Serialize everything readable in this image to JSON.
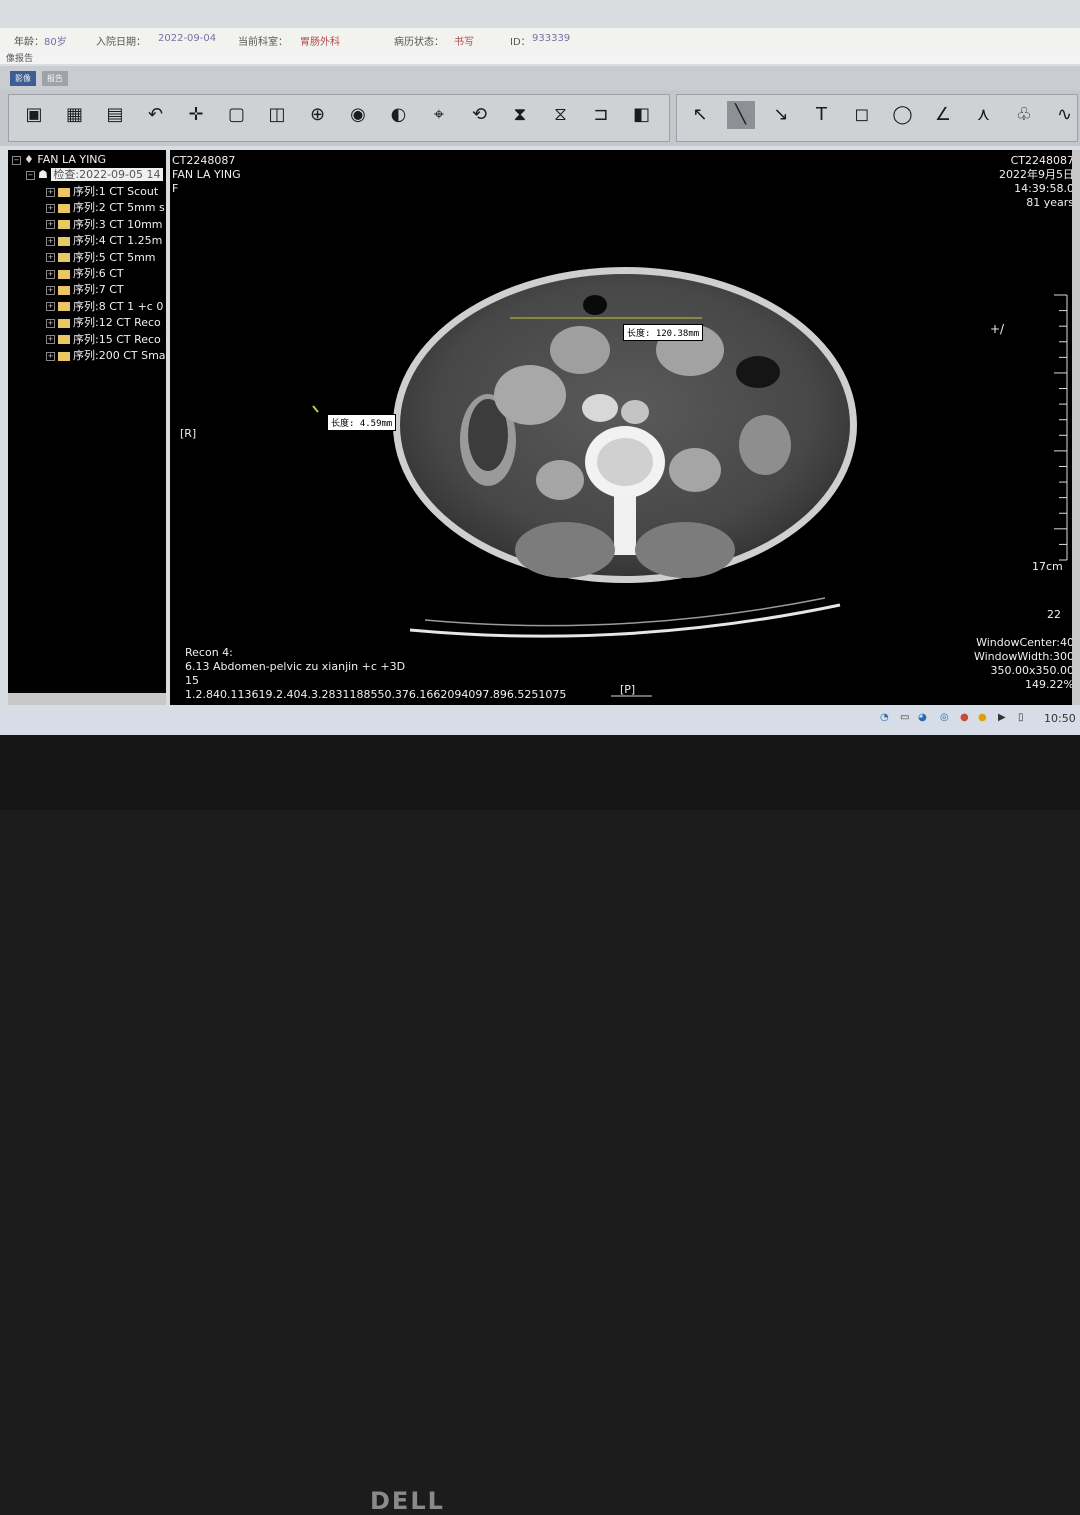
{
  "patient": {
    "age_label": "年龄：",
    "age": "80岁",
    "admit_label": "入院日期：",
    "admit_date": "2022-09-04",
    "dept_label": "当前科室：",
    "dept": "胃肠外科",
    "status_label": "病历状态：",
    "status": "书写",
    "id_label": "ID：",
    "id": "933339"
  },
  "menu": {
    "report": "像报告"
  },
  "tabs": {
    "active": "影像",
    "other": "报告"
  },
  "tree": {
    "patient": "FAN LA YING",
    "study": "检查:2022-09-05 14",
    "series": [
      "序列:1 CT Scout",
      "序列:2 CT 5mm s",
      "序列:3 CT 10mm",
      "序列:4 CT 1.25m",
      "序列:5 CT 5mm",
      "序列:6 CT",
      "序列:7 CT",
      "序列:8 CT 1 +c 0",
      "序列:12 CT Reco",
      "序列:15 CT Reco",
      "序列:200 CT Sma"
    ]
  },
  "overlay": {
    "top_left": [
      "CT2248087",
      "FAN LA YING",
      "F"
    ],
    "top_right": [
      "CT2248087",
      "2022年9月5日",
      "14:39:58.0",
      "81 years"
    ],
    "orient_right": "[R]",
    "orient_posterior": "[P]",
    "bottom_left": [
      "Recon 4:",
      "6.13 Abdomen-pelvic zu xianjin    +c +3D",
      "15",
      "1.2.840.113619.2.404.3.2831188550.376.1662094097.896.5251075"
    ],
    "bottom_right": [
      "WindowCenter:40",
      "WindowWidth:300",
      "350.00x350.00",
      "149.22%"
    ],
    "scale_label": "17cm",
    "slice_number": "22",
    "cursor_glyph": "+/"
  },
  "measurements": {
    "m1": "长度: 120.38mm",
    "m2": "长度: 4.59mm"
  },
  "taskbar": {
    "time": "10:50"
  },
  "monitor": {
    "brand": "DELL"
  },
  "icons": {
    "toolbar_left": [
      "open-icon",
      "layout-grid-icon",
      "series-icon",
      "undo-icon",
      "pan-icon",
      "zoom-box-icon",
      "magnify-region-icon",
      "zoom-icon",
      "magnifier-icon",
      "window-level-icon",
      "crosshair-icon",
      "rotate-icon",
      "flip-vertical-icon",
      "flip-horizontal-icon",
      "reset-icon",
      "invert-icon"
    ],
    "toolbar_right": [
      "pointer-icon",
      "line-icon",
      "arrow-icon",
      "text-icon",
      "rectangle-icon",
      "ellipse-icon",
      "angle-icon",
      "cobb-angle-icon",
      "lung-icon",
      "curve-icon"
    ]
  }
}
